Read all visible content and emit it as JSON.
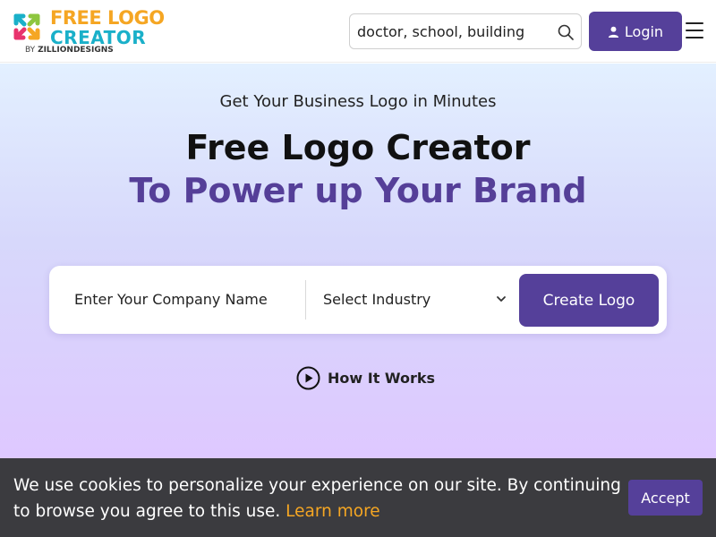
{
  "header": {
    "logo": {
      "line1": "FREE LOGO",
      "line2": "CREATOR",
      "by_prefix": "BY",
      "by_brand": "ZILLIONDESIGNS"
    },
    "search": {
      "value": "doctor, school, building",
      "icon": "search-icon"
    },
    "login_label": "Login",
    "menu_icon": "hamburger-menu-icon"
  },
  "hero": {
    "subtitle": "Get Your Business Logo in Minutes",
    "title_line1": "Free Logo Creator",
    "title_line2": "To Power up Your Brand",
    "form": {
      "company_placeholder": "Enter Your Company Name",
      "industry_selected": "Select Industry",
      "create_label": "Create Logo"
    },
    "how_it_works_label": "How It Works"
  },
  "cookie_banner": {
    "text": "We use cookies to personalize your experience on our site. By continuing to browse you agree to this use.",
    "learn_more_label": "Learn more",
    "accept_label": "Accept"
  },
  "colors": {
    "brand_purple": "#55409a",
    "logo_orange": "#f5a623",
    "logo_teal": "#1ab0c9",
    "banner_bg": "#3b3b3f"
  }
}
